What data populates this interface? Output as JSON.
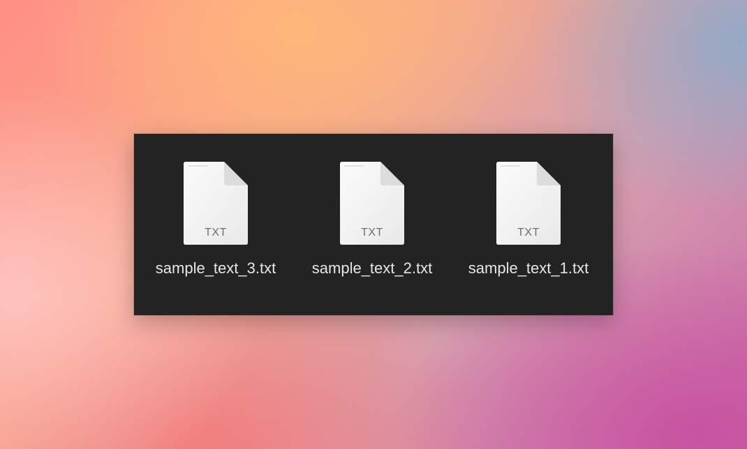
{
  "window": {
    "files": [
      {
        "name": "sample_text_3.txt",
        "ext": "TXT",
        "icon": "txt-document-icon"
      },
      {
        "name": "sample_text_2.txt",
        "ext": "TXT",
        "icon": "txt-document-icon"
      },
      {
        "name": "sample_text_1.txt",
        "ext": "TXT",
        "icon": "txt-document-icon"
      }
    ]
  },
  "colors": {
    "window_background": "#232323",
    "file_label": "#e6e6e6",
    "icon_label": "#6f6f6f"
  }
}
